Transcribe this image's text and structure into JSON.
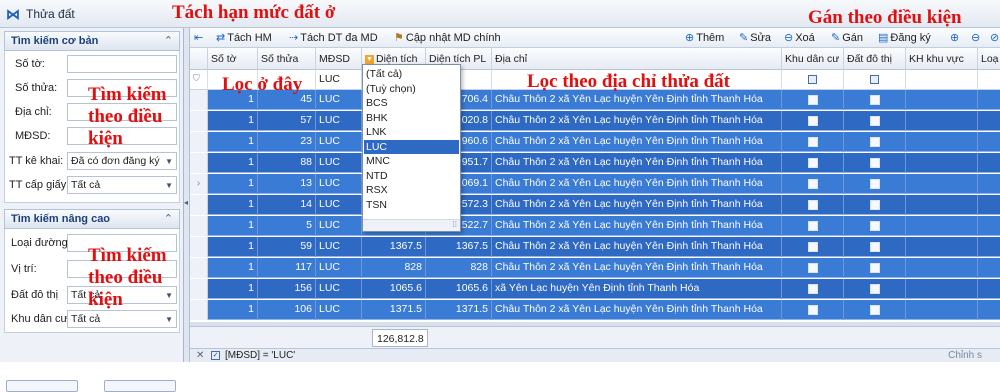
{
  "window": {
    "title": "Thửa đất"
  },
  "annotations": {
    "split_limit": "Tách hạn mức đất ở",
    "assign_condition": "Gán theo điều kiện",
    "filter_here": "Lọc ở đây",
    "filter_address": "Lọc theo địa chỉ thửa đất",
    "search_condition_1": "Tìm kiếm theo điều kiện",
    "search_condition_2": "Tìm kiếm theo điều kiện"
  },
  "left_panel": {
    "basic": {
      "header": "Tìm kiếm cơ bản",
      "so_to": "Số tờ:",
      "so_thua": "Số thửa:",
      "dia_chi": "Địa chỉ:",
      "mdsd": "MĐSD:",
      "tt_ke_khai": "TT kê khai:",
      "tt_ke_khai_value": "Đã có đơn đăng ký",
      "tt_cap_giay": "TT cấp giấy:",
      "tt_cap_giay_value": "Tất cả"
    },
    "advanced": {
      "header": "Tìm kiếm nâng cao",
      "loai_duong": "Loại đường",
      "vi_tri": "Vị trí:",
      "dat_do_thi": "Đất đô thị",
      "dat_do_thi_value": "Tất cả",
      "khu_dan_cu": "Khu dân cư",
      "khu_dan_cu_value": "Tất cả"
    }
  },
  "toolbar": {
    "tach_hm": "Tách HM",
    "tach_dt": "Tách DT đa MD",
    "cap_nhat": "Cập nhật MD chính",
    "them": "Thêm",
    "sua": "Sửa",
    "xoa": "Xoá",
    "gan": "Gán",
    "dang_ky": "Đăng ký"
  },
  "grid": {
    "columns": [
      "Số tờ",
      "Số thửa",
      "MĐSD",
      "Diện tích",
      "Diện tích PL",
      "Địa chỉ",
      "Khu dân cư",
      "Đất đô thị",
      "KH khu vực",
      "Loạ"
    ],
    "filter_mdsd": "LUC",
    "rows": [
      {
        "so_to": "1",
        "so_thua": "45",
        "mdsd": "LUC",
        "dt": "",
        "dtpl": "706.4",
        "dia_chi": "Châu Thôn 2 xã Yên Lạc huyện Yên Định tỉnh Thanh Hóa"
      },
      {
        "so_to": "1",
        "so_thua": "57",
        "mdsd": "LUC",
        "dt": "",
        "dtpl": "1020.8",
        "dia_chi": "Châu Thôn 2 xã Yên Lạc huyện Yên Định tỉnh Thanh Hóa"
      },
      {
        "so_to": "1",
        "so_thua": "23",
        "mdsd": "LUC",
        "dt": "",
        "dtpl": "960.6",
        "dia_chi": "Châu Thôn 2 xã Yên Lạc huyện Yên Định tỉnh Thanh Hóa"
      },
      {
        "so_to": "1",
        "so_thua": "88",
        "mdsd": "LUC",
        "dt": "",
        "dtpl": "951.7",
        "dia_chi": "Châu Thôn 2 xã Yên Lạc huyện Yên Định tỉnh Thanh Hóa"
      },
      {
        "so_to": "1",
        "so_thua": "13",
        "mdsd": "LUC",
        "dt": "",
        "dtpl": "1069.1",
        "dia_chi": "Châu Thôn 2 xã Yên Lạc huyện Yên Định tỉnh Thanh Hóa"
      },
      {
        "so_to": "1",
        "so_thua": "14",
        "mdsd": "LUC",
        "dt": "",
        "dtpl": "1572.3",
        "dia_chi": "Châu Thôn 2 xã Yên Lạc huyện Yên Định tỉnh Thanh Hóa"
      },
      {
        "so_to": "1",
        "so_thua": "5",
        "mdsd": "LUC",
        "dt": "",
        "dtpl": "1522.7",
        "dia_chi": "Châu Thôn 2 xã Yên Lạc huyện Yên Định tỉnh Thanh Hóa"
      },
      {
        "so_to": "1",
        "so_thua": "59",
        "mdsd": "LUC",
        "dt": "1367.5",
        "dtpl": "1367.5",
        "dia_chi": "Châu Thôn 2 xã Yên Lạc huyện Yên Định tỉnh Thanh Hóa"
      },
      {
        "so_to": "1",
        "so_thua": "117",
        "mdsd": "LUC",
        "dt": "828",
        "dtpl": "828",
        "dia_chi": "Châu Thôn 2 xã Yên Lạc huyện Yên Định tỉnh Thanh Hóa"
      },
      {
        "so_to": "1",
        "so_thua": "156",
        "mdsd": "LUC",
        "dt": "1065.6",
        "dtpl": "1065.6",
        "dia_chi": "xã Yên Lạc huyện Yên Định tỉnh Thanh Hóa"
      },
      {
        "so_to": "1",
        "so_thua": "106",
        "mdsd": "LUC",
        "dt": "1371.5",
        "dtpl": "1371.5",
        "dia_chi": "Châu Thôn 2 xã Yên Lạc huyện Yên Định tỉnh Thanh Hóa"
      }
    ],
    "sum_area": "126,812.8"
  },
  "dropdown": {
    "options": [
      "(Tất cả)",
      "(Tuỳ chọn)",
      "BCS",
      "BHK",
      "LNK",
      "LUC",
      "MNC",
      "NTD",
      "RSX",
      "TSN"
    ],
    "selected": "LUC"
  },
  "statusbar": {
    "filter_text": "[MĐSD] = 'LUC'",
    "right_text": "Chỉnh s"
  }
}
